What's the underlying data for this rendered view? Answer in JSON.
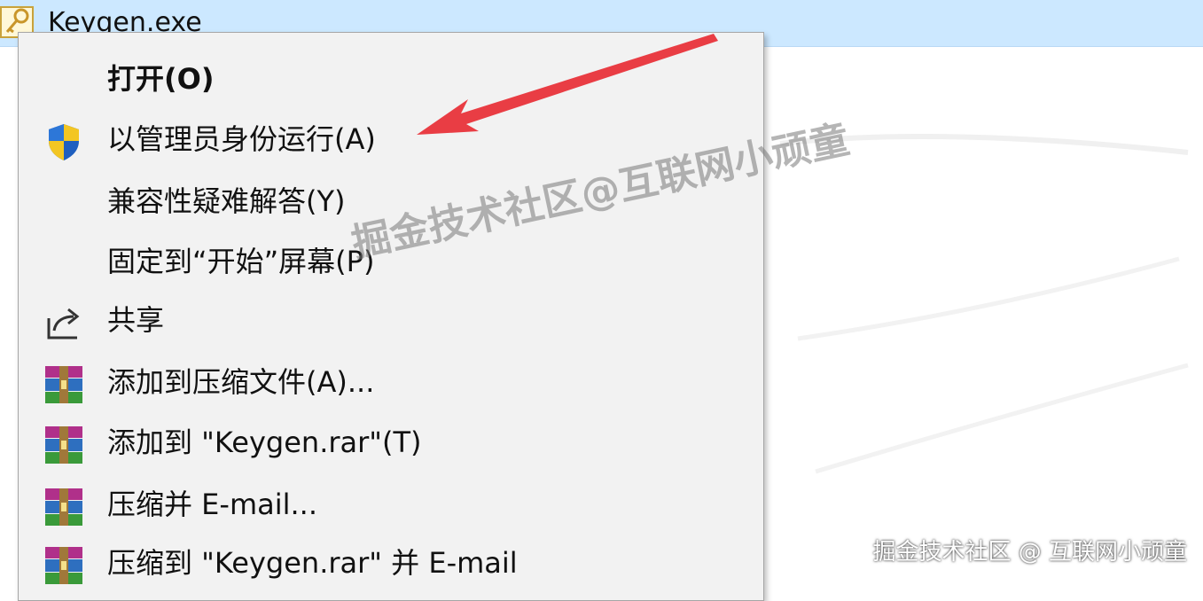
{
  "file": {
    "name": "Keygen.exe",
    "icon": "key-file-icon"
  },
  "menu": {
    "items": [
      {
        "label": "打开(O)",
        "icon": "",
        "bold": true
      },
      {
        "label": "以管理员身份运行(A)",
        "icon": "uac-shield-icon"
      },
      {
        "label": "兼容性疑难解答(Y)",
        "icon": ""
      },
      {
        "label": "固定到“开始”屏幕(P)",
        "icon": ""
      },
      {
        "label": "共享",
        "icon": "share-icon"
      },
      {
        "label": "添加到压缩文件(A)...",
        "icon": "winrar-icon"
      },
      {
        "label": "添加到 \"Keygen.rar\"(T)",
        "icon": "winrar-icon"
      },
      {
        "label": "压缩并 E-mail...",
        "icon": "winrar-icon"
      },
      {
        "label": "压缩到 \"Keygen.rar\" 并 E-mail",
        "icon": "winrar-icon"
      }
    ]
  },
  "annotation": {
    "arrow_color": "#e8333a"
  },
  "watermark": {
    "center_text": "掘金技术社区@互联网小顽童",
    "corner_text": "掘金技术社区 @ 互联网小顽童"
  },
  "colors": {
    "selection": "#cce8ff",
    "menu_bg": "#f2f2f2"
  }
}
